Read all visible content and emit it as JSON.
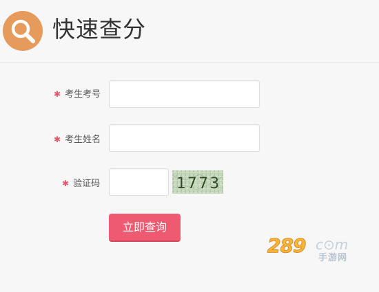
{
  "header": {
    "title": "快速查分",
    "icon": "search-icon",
    "icon_color": "#e69a5c"
  },
  "form": {
    "required_mark": "✱",
    "exam_number": {
      "label": "考生考号",
      "value": ""
    },
    "candidate_name": {
      "label": "考生姓名",
      "value": ""
    },
    "captcha": {
      "label": "验证码",
      "value": "",
      "image_text": "1773"
    },
    "submit_label": "立即查询"
  },
  "colors": {
    "accent": "#ee5a6f",
    "required": "#e5566a",
    "background": "#f7f7f7"
  },
  "watermark": {
    "number": "289",
    "domain": "c⊙m",
    "subtitle": "手游网"
  }
}
